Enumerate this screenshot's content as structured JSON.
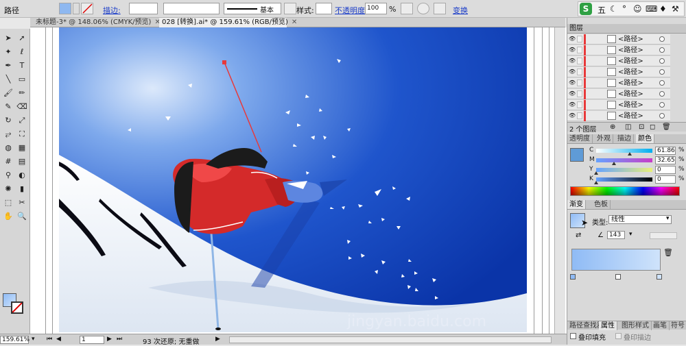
{
  "control_bar": {
    "object_type": "路径",
    "stroke_label": "描边:",
    "stroke_style": "基本",
    "style_label": "样式:",
    "opacity_label": "不透明度:",
    "opacity_value": "100",
    "opacity_unit": "%",
    "transform_label": "变换"
  },
  "ime_toolbar": {
    "mode": "五",
    "icons": [
      "logo-s-icon",
      "moon-icon",
      "dot-icon",
      "smile-icon",
      "keyboard-icon",
      "vest-icon",
      "wrench-icon"
    ]
  },
  "tabs": [
    {
      "label": "未标题-3* @ 148.06% (CMYK/预览)",
      "active": false
    },
    {
      "label": "028 [转换].ai* @ 159.61% (RGB/预览)",
      "active": true
    }
  ],
  "tools": [
    [
      "selection-arrow-icon",
      "direct-selection-icon"
    ],
    [
      "magic-wand-icon",
      "lasso-icon"
    ],
    [
      "pen-icon",
      "type-icon"
    ],
    [
      "line-icon",
      "rectangle-icon"
    ],
    [
      "brush-icon",
      "pencil-icon"
    ],
    [
      "blob-brush-icon",
      "eraser-icon"
    ],
    [
      "rotate-icon",
      "scale-icon"
    ],
    [
      "width-icon",
      "free-transform-icon"
    ],
    [
      "shape-builder-icon",
      "perspective-icon"
    ],
    [
      "mesh-icon",
      "gradient-icon"
    ],
    [
      "eyedropper-icon",
      "blend-icon"
    ],
    [
      "symbol-sprayer-icon",
      "graph-icon"
    ],
    [
      "artboard-icon",
      "slice-icon"
    ],
    [
      "hand-icon",
      "zoom-icon"
    ]
  ],
  "layers_panel": {
    "title": "图层",
    "rows": [
      {
        "label": "<路径>"
      },
      {
        "label": "<路径>"
      },
      {
        "label": "<路径>"
      },
      {
        "label": "<路径>"
      },
      {
        "label": "<路径>"
      },
      {
        "label": "<路径>"
      },
      {
        "label": "<路径>"
      },
      {
        "label": "<路径>"
      }
    ],
    "footer_count": "2 个图层"
  },
  "color_panel": {
    "tabs": [
      "透明度",
      "外观",
      "描边",
      "颜色"
    ],
    "active_tab": "颜色",
    "channels": [
      {
        "label": "C",
        "value": "61.86",
        "unit": "%",
        "level": 0.6186
      },
      {
        "label": "M",
        "value": "32.65",
        "unit": "%",
        "level": 0.3265
      },
      {
        "label": "Y",
        "value": "0",
        "unit": "%",
        "level": 0
      },
      {
        "label": "K",
        "value": "0",
        "unit": "%",
        "level": 0
      }
    ]
  },
  "gradient_panel": {
    "tabs": [
      "渐变",
      "色板"
    ],
    "active_tab": "渐变",
    "type_label": "类型:",
    "type_value": "线性",
    "angle_value": "143",
    "gradient_start": "#8fbbf5",
    "gradient_end": "#cfe3fb"
  },
  "bottom_panel": {
    "tabs": [
      "路径查找器",
      "属性",
      "图形样式",
      "画笔",
      "符号"
    ],
    "overprint_fill": "叠印填充",
    "overprint_stroke": "叠印描边"
  },
  "status_bar": {
    "zoom": "159.61%",
    "artboard_number": "1",
    "message": "93 次还原; 无重做"
  },
  "watermark": "jingyan.baidu.com",
  "colors": {
    "sky_top": "#0d3fb8",
    "sky_glow": "#dce9fb",
    "snow": "#f2f5fa",
    "jacket_red": "#d42a2a",
    "selection_red": "#e8393a",
    "link_blue": "#1a3cc8"
  }
}
